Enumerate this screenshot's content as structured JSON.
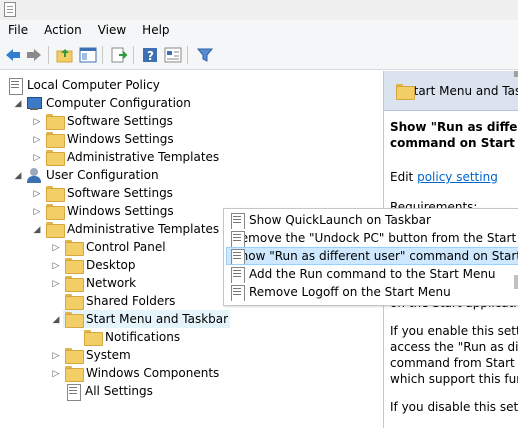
{
  "menu": {
    "file": "File",
    "action": "Action",
    "view": "View",
    "help": "Help"
  },
  "toolbar_icons": [
    "back-arrow-icon",
    "forward-arrow-icon",
    "up-folder-icon",
    "show-hide-tree-icon",
    "export-list-icon",
    "help-icon",
    "properties-icon",
    "filter-icon"
  ],
  "tree": {
    "root": "Local Computer Policy",
    "computer_config": "Computer Configuration",
    "cc_software": "Software Settings",
    "cc_windows": "Windows Settings",
    "cc_admin": "Administrative Templates",
    "user_config": "User Configuration",
    "uc_software": "Software Settings",
    "uc_windows": "Windows Settings",
    "uc_admin": "Administrative Templates",
    "control_panel": "Control Panel",
    "desktop": "Desktop",
    "network": "Network",
    "shared_folders": "Shared Folders",
    "start_menu": "Start Menu and Taskbar",
    "notifications": "Notifications",
    "system": "System",
    "windows_components": "Windows Components",
    "all_settings": "All Settings"
  },
  "popup": {
    "items": [
      "Show QuickLaunch on Taskbar",
      "Remove the \"Undock PC\" button from the Start Me",
      "Show \"Run as different user\" command on Start",
      "Add the Run command to the Start Menu",
      "Remove Logoff on the Start Menu"
    ]
  },
  "right": {
    "header": "Start Menu and Tas",
    "title1": "Show \"Run as different",
    "title2": "command on Start",
    "edit": "Edit",
    "policy_link": "policy setting",
    "requirements": "Requirements:",
    "l1": "on the Start application l",
    "l2": "If you enable this setting,",
    "l3": "access the \"Run as differ",
    "l4": "command from Start for",
    "l5": "which support this functi",
    "l6": "If you disable this setting"
  }
}
